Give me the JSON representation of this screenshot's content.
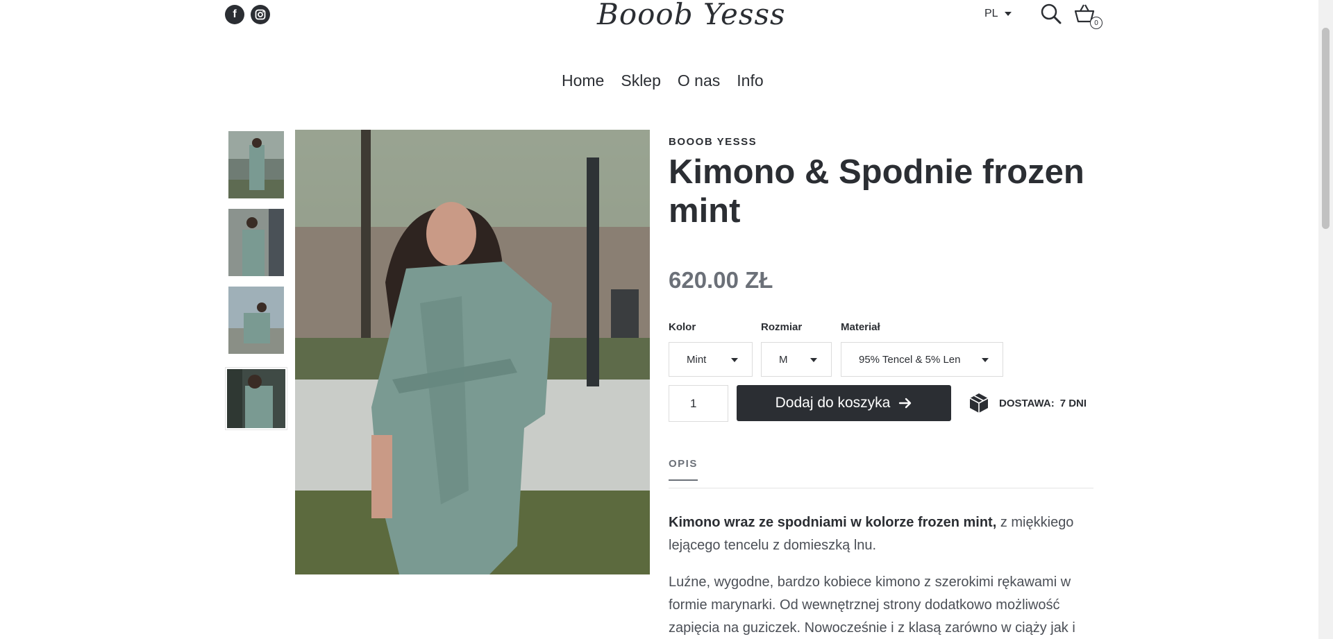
{
  "header": {
    "logo": "Booob Yesss",
    "language": "PL",
    "cart_count": "0",
    "social": [
      "facebook-icon",
      "instagram-icon"
    ]
  },
  "nav": {
    "items": [
      "Home",
      "Sklep",
      "O nas",
      "Info"
    ]
  },
  "product": {
    "brand": "BOOOB YESSS",
    "title": "Kimono & Spodnie frozen mint",
    "price": "620.00 ZŁ",
    "options": [
      {
        "label": "Kolor",
        "value": "Mint"
      },
      {
        "label": "Rozmiar",
        "value": "M"
      },
      {
        "label": "Materiał",
        "value": "95% Tencel & 5% Len"
      }
    ],
    "quantity": "1",
    "add_to_cart": "Dodaj do koszyka",
    "delivery_label": "DOSTAWA:",
    "delivery_value": "7 DNI"
  },
  "description": {
    "tab": "OPIS",
    "p1_bold": "Kimono wraz ze spodniami w kolorze frozen mint,",
    "p1_rest": " z miękkiego lejącego tencelu z domieszką lnu.",
    "p2": "Luźne, wygodne, bardzo kobiece kimono z szerokimi rękawami w formie marynarki. Od wewnętrznej strony dodatkowo możliwość zapięcia na guziczek. Nowocześnie i z klasą zarówno w ciąży jak i"
  },
  "colors": {
    "text": "#2b2e33",
    "muted": "#6b7078",
    "button": "#2b2e33",
    "product": "#7a9a92"
  }
}
